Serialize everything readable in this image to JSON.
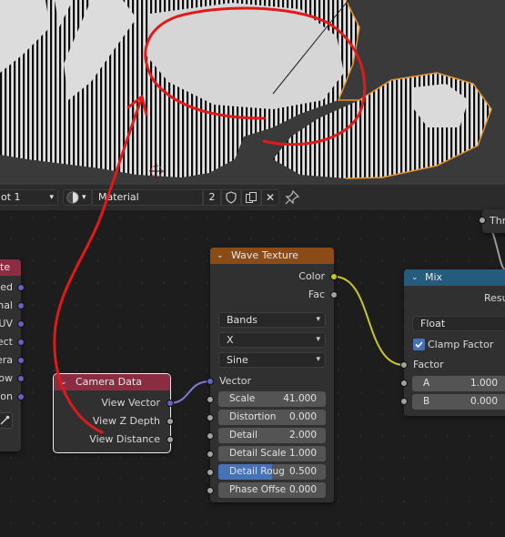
{
  "header": {
    "slot_label": "ot 1",
    "material_name": "Material",
    "user_count": "2"
  },
  "nodes": {
    "left_partial": {
      "outputs": [
        "cted",
        "rnal",
        "UV",
        "ject",
        "era",
        "dow",
        "tion"
      ]
    },
    "camera_data": {
      "title": "Camera Data",
      "outputs": [
        "View Vector",
        "View Z Depth",
        "View Distance"
      ]
    },
    "wave_texture": {
      "title": "Wave Texture",
      "outputs": [
        "Color",
        "Fac"
      ],
      "type": "Bands",
      "direction": "X",
      "profile": "Sine",
      "input_vector": "Vector",
      "fields": [
        {
          "label": "Scale",
          "value": "41.000"
        },
        {
          "label": "Distortion",
          "value": "0.000"
        },
        {
          "label": "Detail",
          "value": "2.000"
        },
        {
          "label": "Detail Scale",
          "value": "1.000"
        },
        {
          "label": "Detail Roug",
          "value": "0.500",
          "fill": 0.5
        },
        {
          "label": "Phase Offse",
          "value": "0.000"
        }
      ]
    },
    "mix": {
      "title": "Mix",
      "output": "Resu",
      "data_type": "Float",
      "clamp_label": "Clamp Factor",
      "clamp_checked": true,
      "factor_label": "Factor",
      "a_label": "A",
      "a_value": "1.000",
      "b_label": "B",
      "b_value": "0.000"
    },
    "threshold_partial": {
      "label": "Thr"
    }
  },
  "colors": {
    "wave_header": "#8a4b16",
    "camera_header": "#8c2c42",
    "mix_header": "#255c7e",
    "annotation": "#e01a1a"
  }
}
